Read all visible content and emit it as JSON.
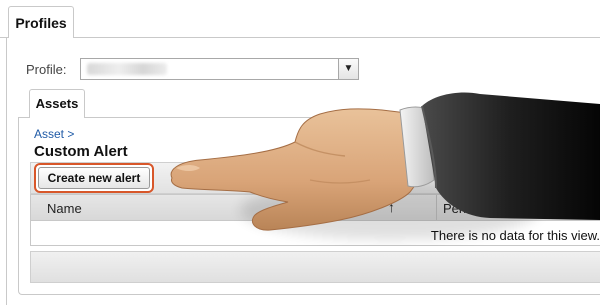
{
  "top_tabs": [
    {
      "label": "Profiles"
    }
  ],
  "profile": {
    "label": "Profile:",
    "selected_value": "",
    "dropdown_glyph": "▼"
  },
  "sub_tabs": [
    {
      "label": "Assets"
    }
  ],
  "breadcrumb": "Asset >",
  "page_title": "Custom Alert",
  "toolbar": {
    "create_label": "Create new alert"
  },
  "table": {
    "columns": [
      {
        "label": "Name",
        "sort_glyph": "↑"
      },
      {
        "label": "Perio"
      }
    ],
    "empty_message": "There is no data for this view."
  },
  "overlay": {
    "icon": "pointing-hand-icon",
    "highlight_color": "#d8572a"
  }
}
